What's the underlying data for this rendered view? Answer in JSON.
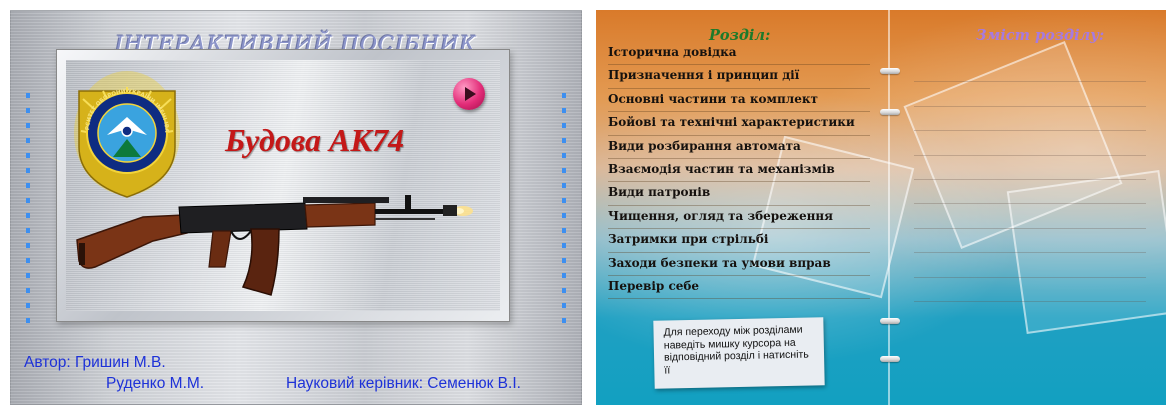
{
  "left_slide": {
    "title": "ІНТЕРАКТИВНИЙ ПОСІБНИК",
    "product_title": "Будова АК74",
    "emblem_text": "НАЦІОНАЛЬНИЙ УНІВЕРСИТЕТ ОБОРОНИ УКРАЇНИ ІМЕНІ ІВАНА ЧЕРНЯХОВСЬКОГО",
    "play_button": {
      "icon": "play-icon"
    },
    "author_label": "Автор: Гришин М.В.",
    "author_2": "Руденко М.М.",
    "supervisor": "Науковий керівник: Семенюк В.І."
  },
  "right_slide": {
    "sections_heading": "Розділ:",
    "contents_heading": "Зміст розділу:",
    "sections": [
      "Історична довідка",
      "Призначення і принцип дії",
      "Основні частини та комплект",
      "Бойові та технічні характеристики",
      "Види розбирання автомата",
      "Взаємодія частин та механізмів",
      "Види патронів",
      "Чищення, огляд та збереження",
      "Затримки при стрільбі",
      "Заходи безпеки та умови вправ",
      "Перевір себе"
    ],
    "hint": "Для переходу між розділами наведіть мишку курсора на відповідний розділ і натисніть її"
  },
  "colors": {
    "title_lavender": "#8c95ca",
    "product_title_red": "#c41818",
    "credits_blue": "#1e32d8",
    "section_heading_green": "#1d7a2a",
    "contents_heading_purple": "#a77adf",
    "play_button_pink": "#e22c78"
  }
}
